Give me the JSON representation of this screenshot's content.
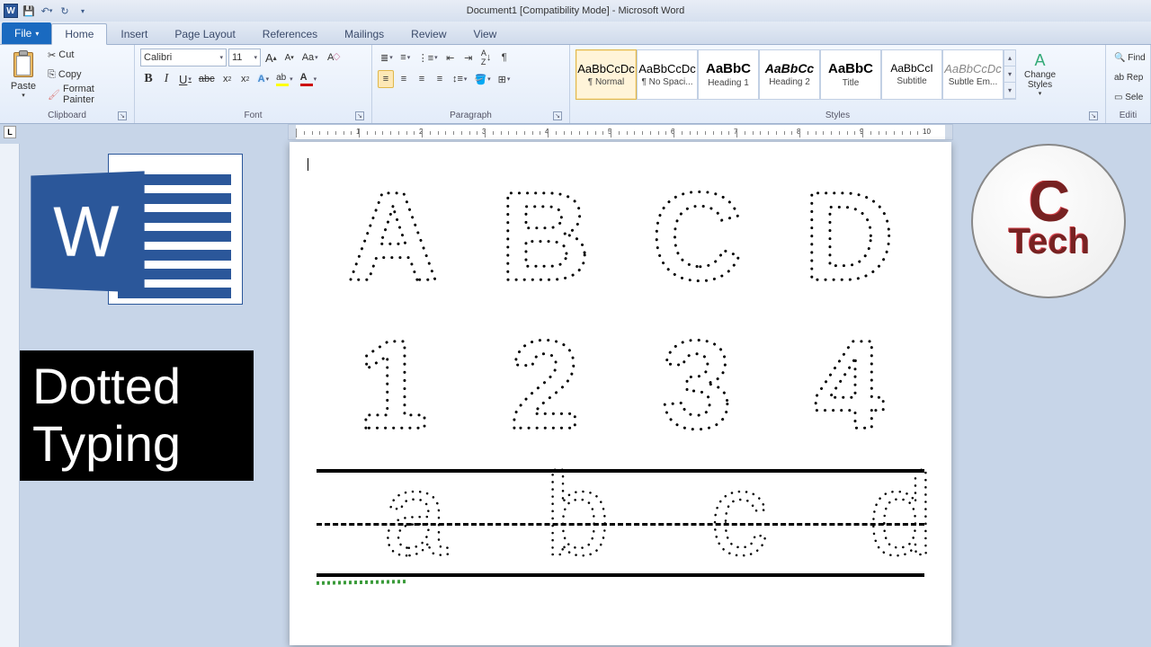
{
  "title": "Document1 [Compatibility Mode] - Microsoft Word",
  "tabs": {
    "file": "File",
    "home": "Home",
    "insert": "Insert",
    "pagelayout": "Page Layout",
    "references": "References",
    "mailings": "Mailings",
    "review": "Review",
    "view": "View"
  },
  "clipboard": {
    "paste": "Paste",
    "cut": "Cut",
    "copy": "Copy",
    "fmt": "Format Painter",
    "label": "Clipboard"
  },
  "font": {
    "name": "Calibri",
    "size": "11",
    "label": "Font",
    "B": "B",
    "I": "I",
    "U": "U",
    "abc": "abc",
    "x2": "x",
    "Aa": "Aa",
    "A": "A"
  },
  "para": {
    "label": "Paragraph"
  },
  "styles": {
    "label": "Styles",
    "items": [
      {
        "prev": "AaBbCcDc",
        "name": "¶ Normal",
        "sel": true,
        "cls": ""
      },
      {
        "prev": "AaBbCcDc",
        "name": "¶ No Spaci...",
        "cls": ""
      },
      {
        "prev": "AaBbC",
        "name": "Heading 1",
        "cls": "font-weight:bold;font-size:15px;"
      },
      {
        "prev": "AaBbCc",
        "name": "Heading 2",
        "cls": "font-weight:bold;font-style:italic;font-size:14px;"
      },
      {
        "prev": "AaBbC",
        "name": "Title",
        "cls": "font-weight:bold;font-size:15px;"
      },
      {
        "prev": "AaBbCcI",
        "name": "Subtitle",
        "cls": "font-size:12px;"
      },
      {
        "prev": "AaBbCcDc",
        "name": "Subtle Em...",
        "cls": "font-style:italic;color:#888;"
      }
    ],
    "change": "Change Styles"
  },
  "editing": {
    "find": "Find",
    "replace": "Rep",
    "select": "Sele",
    "label": "Editi"
  },
  "doc": {
    "row1": [
      "A",
      "B",
      "C",
      "D"
    ],
    "row2": [
      "1",
      "2",
      "3",
      "4"
    ],
    "lc": [
      "a",
      "b",
      "c",
      "d"
    ]
  },
  "overlay": {
    "line1": "Dotted",
    "line2": "Typing",
    "ctech1": "C",
    "ctech2": "Tech"
  },
  "ruler": {
    "nums": [
      "1",
      "2",
      "3",
      "4",
      "5",
      "6",
      "7",
      "8",
      "9",
      "10"
    ]
  }
}
